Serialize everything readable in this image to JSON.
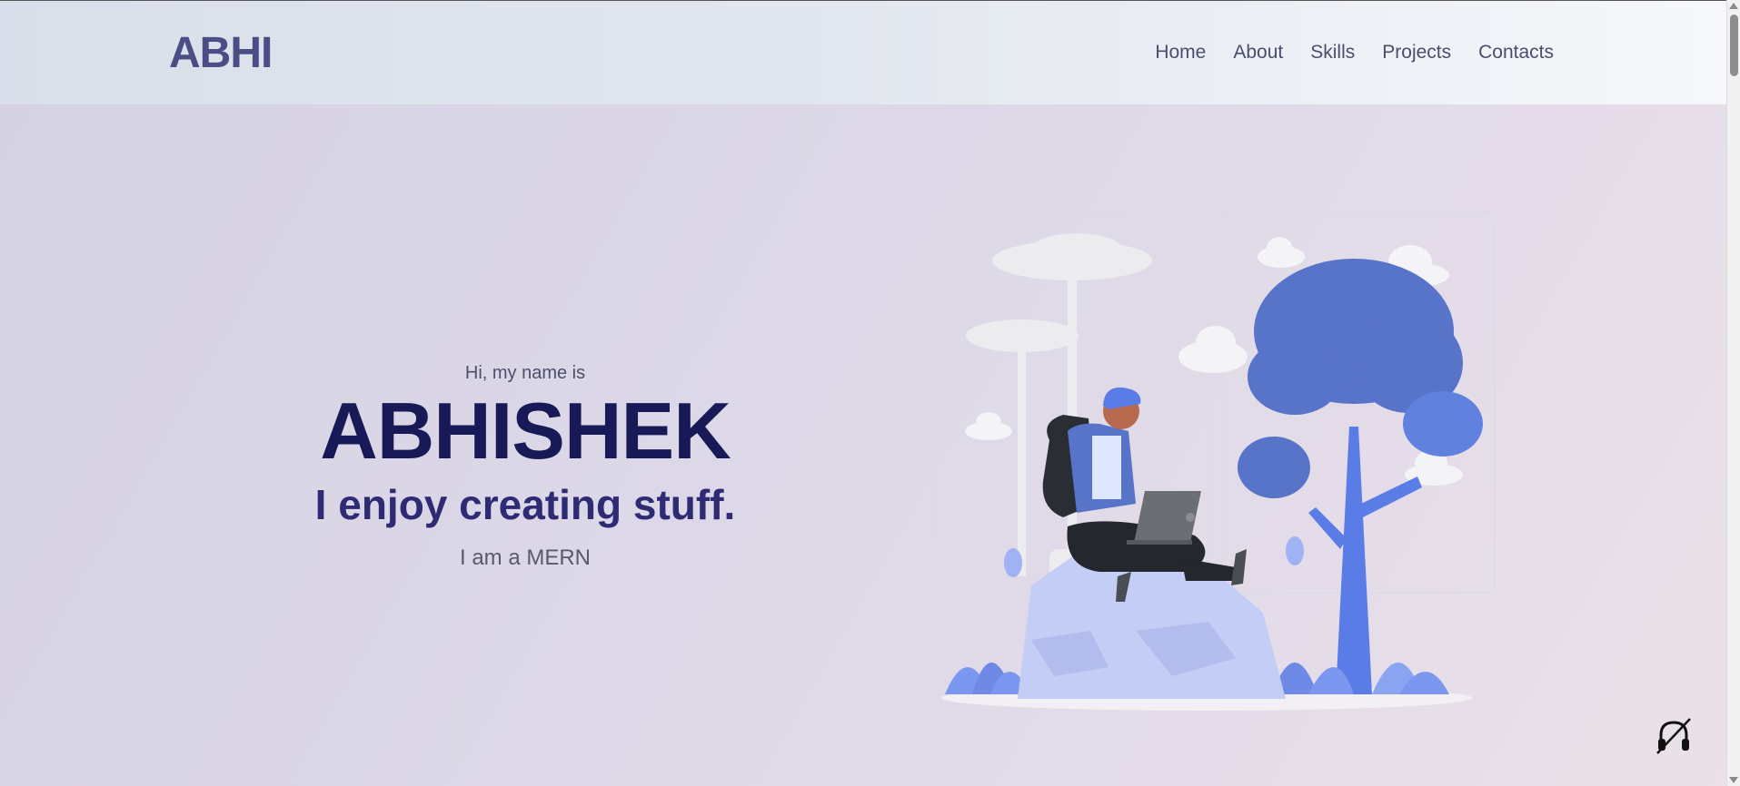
{
  "header": {
    "logo": "ABHI",
    "nav": [
      "Home",
      "About",
      "Skills",
      "Projects",
      "Contacts"
    ]
  },
  "hero": {
    "greeting": "Hi, my name is",
    "name": "ABHISHEK",
    "tagline": "I enjoy creating stuff.",
    "role": "I am a MERN"
  },
  "icons": {
    "audio_toggle": "muted-headphones-icon"
  },
  "colors": {
    "logo": "#4a4e85",
    "name": "#171a57",
    "tagline": "#2e2a74",
    "illustration_blue": "#5874c9",
    "illustration_light": "#c3cdf5"
  }
}
